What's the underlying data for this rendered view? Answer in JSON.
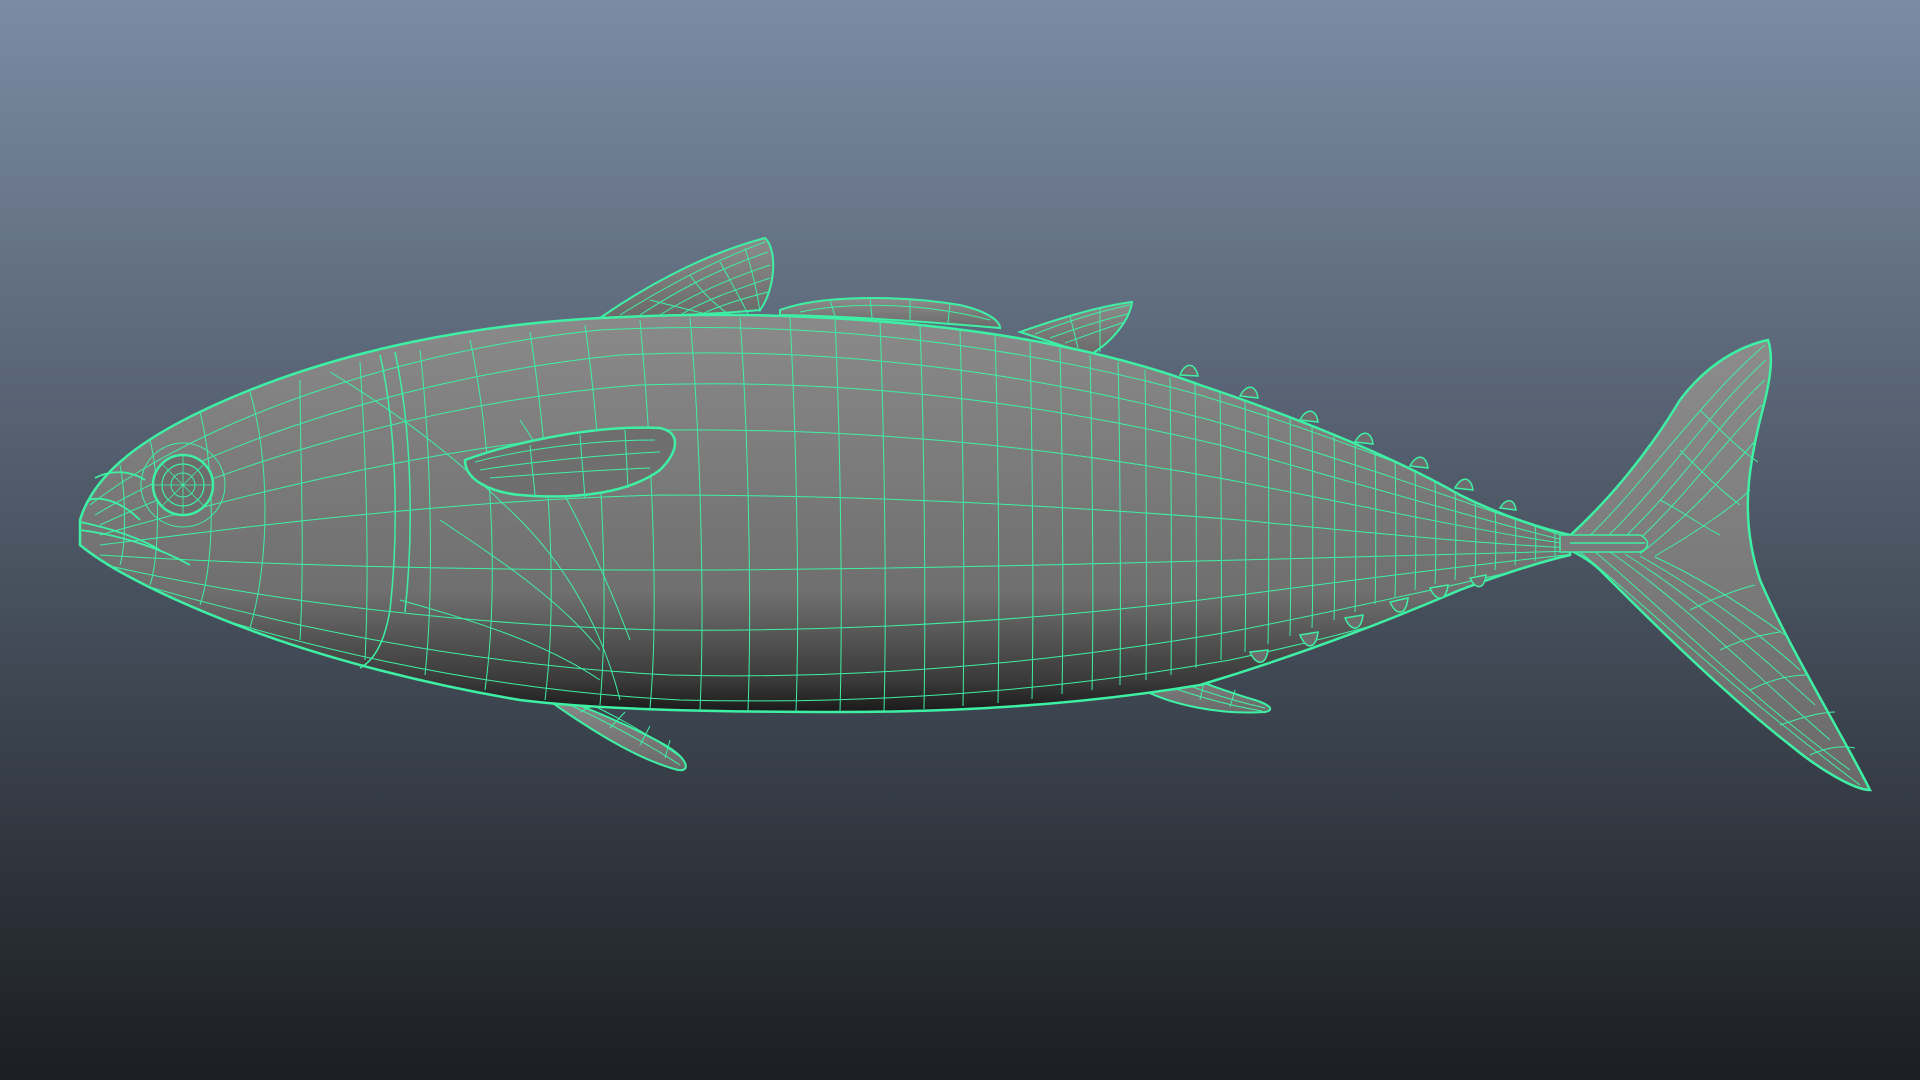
{
  "viewport": {
    "background_top": "#7c8ba3",
    "background_bottom": "#1b1e22"
  },
  "model": {
    "display_mode": "wireframe-on-shaded",
    "wire_color": "#3ef0a4",
    "shade_color": "#7a7a7a"
  }
}
